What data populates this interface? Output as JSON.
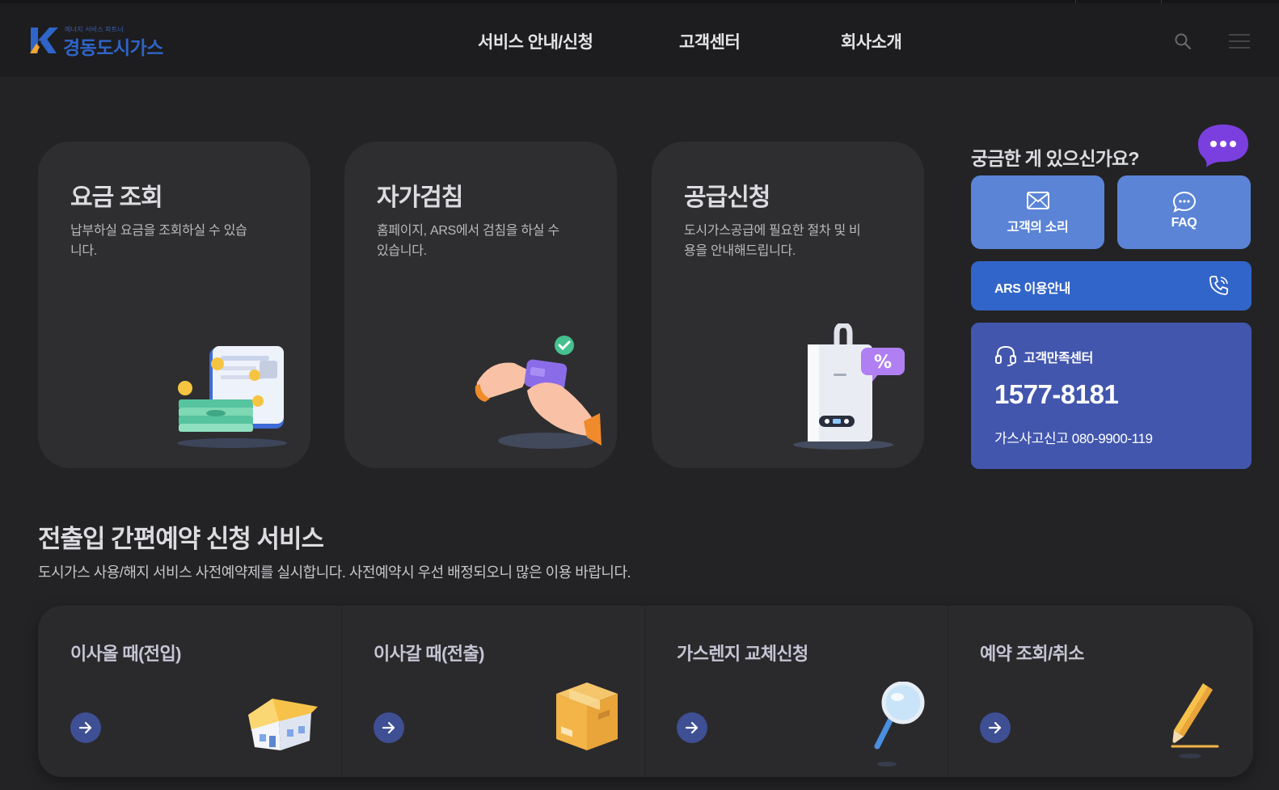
{
  "header": {
    "logo": {
      "tagline": "에너지 서비스 파트너",
      "name": "경동도시가스"
    },
    "nav": [
      {
        "label": "서비스 안내/신청"
      },
      {
        "label": "고객센터"
      },
      {
        "label": "회사소개"
      }
    ],
    "icons": [
      "search-icon",
      "menu-icon"
    ]
  },
  "cards": [
    {
      "title": "요금 조회",
      "desc": "납부하실 요금을 조회하실 수 있습니다.",
      "icon": "bill-illustration"
    },
    {
      "title": "자가검침",
      "desc": "홈페이지, ARS에서 검침을 하실 수 있습니다.",
      "icon": "phone-in-hand-illustration"
    },
    {
      "title": "공급신청",
      "desc": "도시가스공급에 필요한 절차 및 비용을 안내해드립니다.",
      "icon": "boiler-illustration"
    }
  ],
  "side": {
    "question": "궁금한 게 있으신가요?",
    "buttons": [
      {
        "label": "고객의 소리",
        "icon": "mail-icon"
      },
      {
        "label": "FAQ",
        "icon": "chat-icon"
      }
    ],
    "ars": {
      "label": "ARS 이용안내",
      "icon": "phone-icon"
    },
    "cs": {
      "label": "고객만족센터",
      "phone": "1577-8181",
      "emergency": "가스사고신고 080-9900-119",
      "icon": "headset-icon"
    }
  },
  "reservation": {
    "title": "전출입 간편예약 신청 서비스",
    "desc": "도시가스 사용/해지 서비스 사전예약제를 실시합니다. 사전예약시 우선 배정되오니 많은 이용 바랍니다.",
    "items": [
      {
        "title": "이사올 때(전입)",
        "icon": "house-illustration"
      },
      {
        "title": "이사갈 때(전출)",
        "icon": "box-illustration"
      },
      {
        "title": "가스렌지 교체신청",
        "icon": "magnifier-illustration"
      },
      {
        "title": "예약 조회/취소",
        "icon": "pencil-illustration"
      }
    ]
  },
  "colors": {
    "background": "#232325",
    "header": "#1d1d1f",
    "card": "#2e2e30",
    "button_light_blue": "#5b84d6",
    "button_blue": "#3265c9",
    "cs_panel": "#4256ad",
    "arrow_circle": "#3e4f94",
    "bubble_purple": "#7b3fe0"
  }
}
